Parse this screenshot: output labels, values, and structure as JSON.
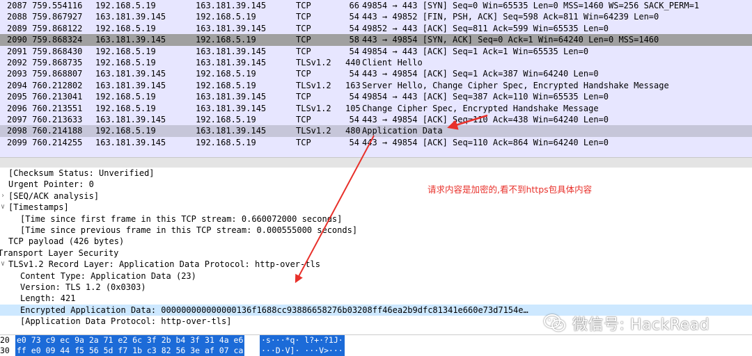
{
  "packets": [
    {
      "no": "2087",
      "time": "759.554116",
      "src": "192.168.5.19",
      "dst": "163.181.39.145",
      "proto": "TCP",
      "len": "66",
      "info": "49854 → 443 [SYN] Seq=0 Win=65535 Len=0 MSS=1460 WS=256 SACK_PERM=1",
      "style": "normal"
    },
    {
      "no": "2088",
      "time": "759.867927",
      "src": "163.181.39.145",
      "dst": "192.168.5.19",
      "proto": "TCP",
      "len": "54",
      "info": "443 → 49852 [FIN, PSH, ACK] Seq=598 Ack=811 Win=64239 Len=0",
      "style": "normal"
    },
    {
      "no": "2089",
      "time": "759.868122",
      "src": "192.168.5.19",
      "dst": "163.181.39.145",
      "proto": "TCP",
      "len": "54",
      "info": "49852 → 443 [ACK] Seq=811 Ack=599 Win=65535 Len=0",
      "style": "normal"
    },
    {
      "no": "2090",
      "time": "759.868324",
      "src": "163.181.39.145",
      "dst": "192.168.5.19",
      "proto": "TCP",
      "len": "58",
      "info": "443 → 49854 [SYN, ACK] Seq=0 Ack=1 Win=64240 Len=0 MSS=1460",
      "style": "gray"
    },
    {
      "no": "2091",
      "time": "759.868430",
      "src": "192.168.5.19",
      "dst": "163.181.39.145",
      "proto": "TCP",
      "len": "54",
      "info": "49854 → 443 [ACK] Seq=1 Ack=1 Win=65535 Len=0",
      "style": "normal"
    },
    {
      "no": "2092",
      "time": "759.868735",
      "src": "192.168.5.19",
      "dst": "163.181.39.145",
      "proto": "TLSv1.2",
      "len": "440",
      "info": "Client Hello",
      "style": "normal"
    },
    {
      "no": "2093",
      "time": "759.868807",
      "src": "163.181.39.145",
      "dst": "192.168.5.19",
      "proto": "TCP",
      "len": "54",
      "info": "443 → 49854 [ACK] Seq=1 Ack=387 Win=64240 Len=0",
      "style": "normal"
    },
    {
      "no": "2094",
      "time": "760.212802",
      "src": "163.181.39.145",
      "dst": "192.168.5.19",
      "proto": "TLSv1.2",
      "len": "163",
      "info": "Server Hello, Change Cipher Spec, Encrypted Handshake Message",
      "style": "normal"
    },
    {
      "no": "2095",
      "time": "760.213041",
      "src": "192.168.5.19",
      "dst": "163.181.39.145",
      "proto": "TCP",
      "len": "54",
      "info": "49854 → 443 [ACK] Seq=387 Ack=110 Win=65535 Len=0",
      "style": "normal"
    },
    {
      "no": "2096",
      "time": "760.213551",
      "src": "192.168.5.19",
      "dst": "163.181.39.145",
      "proto": "TLSv1.2",
      "len": "105",
      "info": "Change Cipher Spec, Encrypted Handshake Message",
      "style": "normal"
    },
    {
      "no": "2097",
      "time": "760.213633",
      "src": "163.181.39.145",
      "dst": "192.168.5.19",
      "proto": "TCP",
      "len": "54",
      "info": "443 → 49854 [ACK] Seq=110 Ack=438 Win=64240 Len=0",
      "style": "normal"
    },
    {
      "no": "2098",
      "time": "760.214188",
      "src": "192.168.5.19",
      "dst": "163.181.39.145",
      "proto": "TLSv1.2",
      "len": "480",
      "info": "Application Data",
      "style": "selected"
    },
    {
      "no": "2099",
      "time": "760.214255",
      "src": "163.181.39.145",
      "dst": "192.168.5.19",
      "proto": "TCP",
      "len": "54",
      "info": "443 → 49854 [ACK] Seq=110 Ack=864 Win=64240 Len=0",
      "style": "normal"
    }
  ],
  "details": [
    {
      "text": "[Checksum Status: Unverified]",
      "indent": 1,
      "twisty": "",
      "hl": false
    },
    {
      "text": "Urgent Pointer: 0",
      "indent": 1,
      "twisty": "",
      "hl": false
    },
    {
      "text": "[SEQ/ACK analysis]",
      "indent": 1,
      "twisty": ">",
      "hl": false
    },
    {
      "text": "[Timestamps]",
      "indent": 1,
      "twisty": "v",
      "hl": false
    },
    {
      "text": "[Time since first frame in this TCP stream: 0.660072000 seconds]",
      "indent": 2,
      "twisty": "",
      "hl": false
    },
    {
      "text": "[Time since previous frame in this TCP stream: 0.000555000 seconds]",
      "indent": 2,
      "twisty": "",
      "hl": false
    },
    {
      "text": "TCP payload (426 bytes)",
      "indent": 1,
      "twisty": "",
      "hl": false
    },
    {
      "text": "Transport Layer Security",
      "indent": 0,
      "twisty": "",
      "hl": false
    },
    {
      "text": "TLSv1.2 Record Layer: Application Data Protocol: http-over-tls",
      "indent": 1,
      "twisty": "v",
      "hl": false
    },
    {
      "text": "Content Type: Application Data (23)",
      "indent": 2,
      "twisty": "",
      "hl": false
    },
    {
      "text": "Version: TLS 1.2 (0x0303)",
      "indent": 2,
      "twisty": "",
      "hl": false
    },
    {
      "text": "Length: 421",
      "indent": 2,
      "twisty": "",
      "hl": false
    },
    {
      "text": "Encrypted Application Data: 000000000000000136f1688cc93886658276b03208ff46ea2b9dfc81341e660e73d7154e…",
      "indent": 2,
      "twisty": "",
      "hl": true
    },
    {
      "text": "[Application Data Protocol: http-over-tls]",
      "indent": 2,
      "twisty": "",
      "hl": false
    }
  ],
  "annotation": {
    "text": "请求内容是加密的,看不到https包具体内容",
    "color": "#e8302a"
  },
  "watermark": {
    "text": "微信号: HackRead",
    "icon": "wechat-icon"
  },
  "hex": [
    {
      "offset": "20",
      "bytes": "e0 73 c9 ec 9a 2a 71 e2  6c 3f 2b b4 3f 31 4a e6",
      "ascii": "·s···*q· l?+·?1J·"
    },
    {
      "offset": "30",
      "bytes": "ff e0 09 44 f5 56 5d f7  1b c3 82 56 3e af 07 ca",
      "ascii": "···D·V]· ···V>···"
    }
  ],
  "colors": {
    "row_normal": "#e7e6ff",
    "row_gray": "#a0a0a0",
    "row_selected": "#c6c6d9",
    "detail_highlight": "#cde8ff",
    "hex_highlight": "#1c6bd8"
  }
}
